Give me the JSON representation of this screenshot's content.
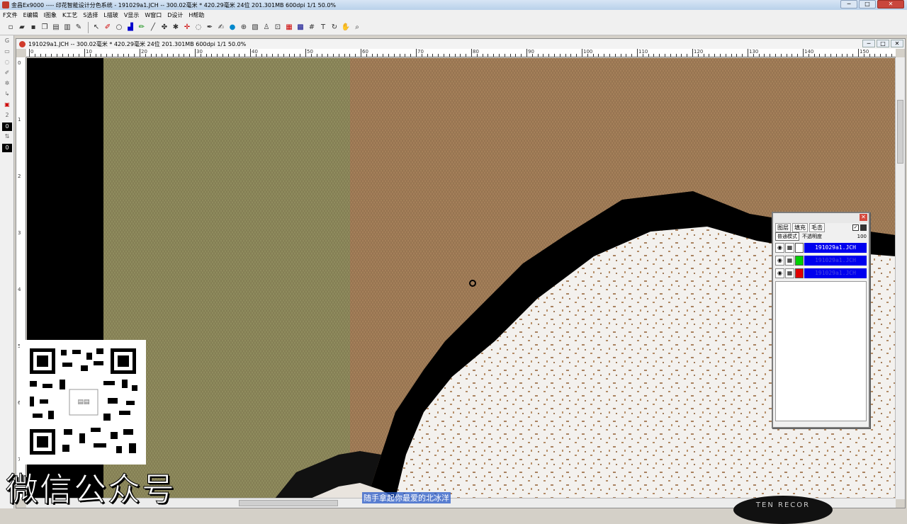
{
  "window": {
    "title": "金昌Ex9000 ---- 印花智能设计分色系统 - 191029a1.JCH -- 300.02毫米 * 420.29毫米 24位 201.301MB 600dpi 1/1  50.0%",
    "minimize": "─",
    "maximize": "□",
    "close": "✕"
  },
  "menu": [
    "F文件",
    "E编辑",
    "I图象",
    "K工艺",
    "S选择",
    "L描玻",
    "V显示",
    "W窗口",
    "D设计",
    "H帮助"
  ],
  "document": {
    "title": "191029a1.JCH -- 300.02毫米 * 420.29毫米 24位 201.301MB 600dpi 1/1  50.0%",
    "ruler_labels": [
      "0",
      "10",
      "20",
      "30",
      "40",
      "50",
      "60",
      "70",
      "80",
      "90",
      "100",
      "110",
      "120",
      "130",
      "140",
      "150"
    ],
    "vruler_labels": [
      "0",
      "1",
      "2",
      "3",
      "4",
      "5",
      "6",
      "7"
    ]
  },
  "left_tools": [
    "G",
    "2",
    "0",
    "0"
  ],
  "layers_panel": {
    "tabs": [
      "图层",
      "填充",
      "毛击"
    ],
    "mode": "普通模式",
    "opacity_label": "不透明度",
    "opacity_value": "100",
    "layers": [
      {
        "name": "191029a1.JCH",
        "color": "#ffffff"
      },
      {
        "name": "191029a1.JCH",
        "color": "#00d000"
      },
      {
        "name": "191029a1.JCH",
        "color": "#e00000"
      }
    ]
  },
  "overlay": {
    "wechat_text": "微信公众号",
    "subtitle": "随手拿起你最爱的北冰洋",
    "badge_text": "TEN RECOR"
  }
}
